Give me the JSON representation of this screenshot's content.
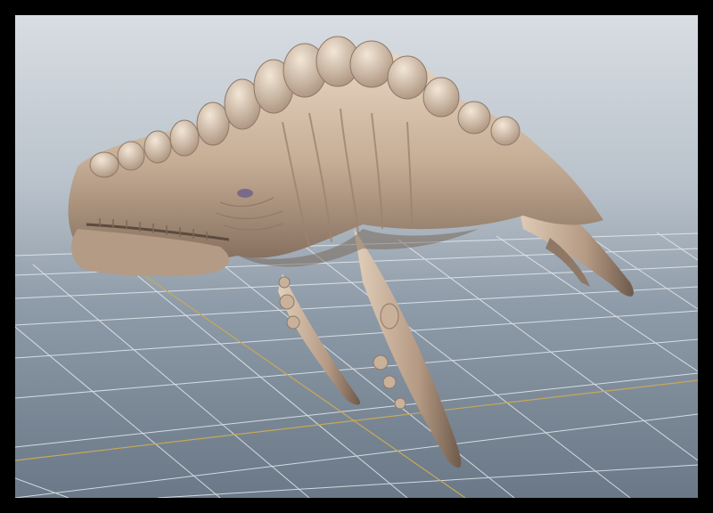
{
  "viewport": {
    "background_top": "#d8dde2",
    "background_bottom": "#6a7887",
    "grid_color": "#e6ebf0",
    "axis_color": "#c8a85a"
  },
  "model": {
    "icon": "sculpted-creature-model",
    "skin_color": "#c8b09a",
    "shadow_color": "#6e5a4a",
    "highlight_color": "#efe0cf"
  }
}
